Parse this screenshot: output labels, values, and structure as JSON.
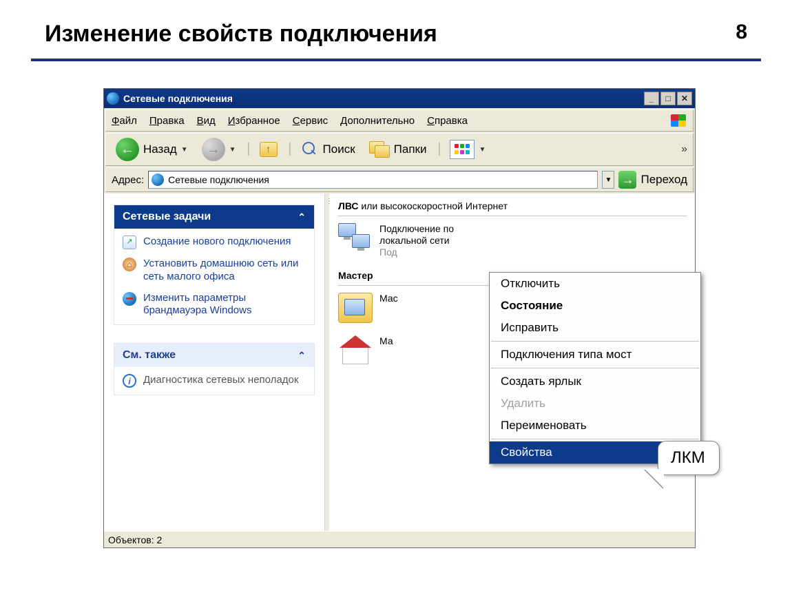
{
  "slide": {
    "title": "Изменение свойств подключения",
    "number": "8"
  },
  "window": {
    "title": "Сетевые подключения"
  },
  "menubar": [
    "Файл",
    "Правка",
    "Вид",
    "Избранное",
    "Сервис",
    "Дополнительно",
    "Справка"
  ],
  "toolbar": {
    "back": "Назад",
    "search": "Поиск",
    "folders": "Папки",
    "more": "»"
  },
  "addressbar": {
    "label": "Адрес:",
    "value": "Сетевые подключения",
    "go": "Переход"
  },
  "sidepanel": {
    "tasks": {
      "header": "Сетевые задачи",
      "items": [
        "Создание нового подключения",
        "Установить домашнюю сеть или сеть малого офиса",
        "Изменить параметры брандмауэра Windows"
      ]
    },
    "seealso": {
      "header": "См. также",
      "items": [
        "Диагностика сетевых неполадок"
      ]
    }
  },
  "main": {
    "group1": {
      "prefix": "ЛВС",
      "rest": " или высокоскоростной Интернет"
    },
    "connection_name": "Подключение по локальной сети",
    "connection_sub": "Под",
    "group2": "Мастер",
    "item2_prefix": "Мас",
    "item3_prefix": "Ма"
  },
  "context_menu": {
    "items": [
      {
        "label": "Отключить",
        "type": "normal"
      },
      {
        "label": "Состояние",
        "type": "bold"
      },
      {
        "label": "Исправить",
        "type": "normal"
      },
      {
        "type": "sep"
      },
      {
        "label": "Подключения типа мост",
        "type": "normal"
      },
      {
        "type": "sep"
      },
      {
        "label": "Создать ярлык",
        "type": "normal"
      },
      {
        "label": "Удалить",
        "type": "disabled"
      },
      {
        "label": "Переименовать",
        "type": "normal"
      },
      {
        "type": "sep"
      },
      {
        "label": "Свойства",
        "type": "selected"
      }
    ]
  },
  "callout": "ЛКМ",
  "statusbar": "Объектов: 2"
}
